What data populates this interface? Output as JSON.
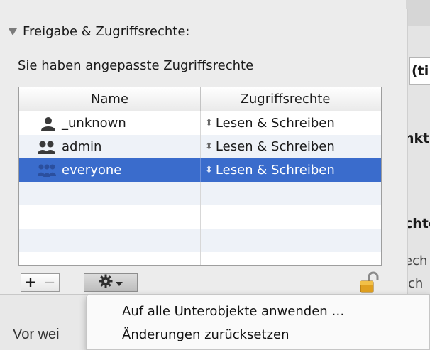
{
  "background_window": {
    "field_text": "(ti",
    "text_1": "nkt",
    "text_2": "chte",
    "text_3": "ech",
    "text_4": "ich"
  },
  "sharing": {
    "section_title": "Freigabe & Zugriffsrechte:",
    "custom_note": "Sie haben angepasste Zugriffsrechte",
    "columns": {
      "name": "Name",
      "rights": "Zugriffsrechte"
    },
    "rows": [
      {
        "name": "_unknown",
        "rights": "Lesen & Schreiben",
        "icon": "single-user-icon",
        "selected": false
      },
      {
        "name": "admin",
        "rights": "Lesen & Schreiben",
        "icon": "group-icon",
        "selected": false
      },
      {
        "name": "everyone",
        "rights": "Lesen & Schreiben",
        "icon": "everyone-group-icon",
        "selected": true
      }
    ],
    "buttons": {
      "add": "+",
      "remove": "−"
    }
  },
  "footer_text": "Vor wei",
  "context_menu": {
    "items": [
      "Auf alle Unterobjekte anwenden …",
      "Änderungen zurücksetzen"
    ]
  },
  "colors": {
    "selection": "#3a6ccc",
    "alt_row": "#eef2f8",
    "panel_bg": "#ececec"
  }
}
